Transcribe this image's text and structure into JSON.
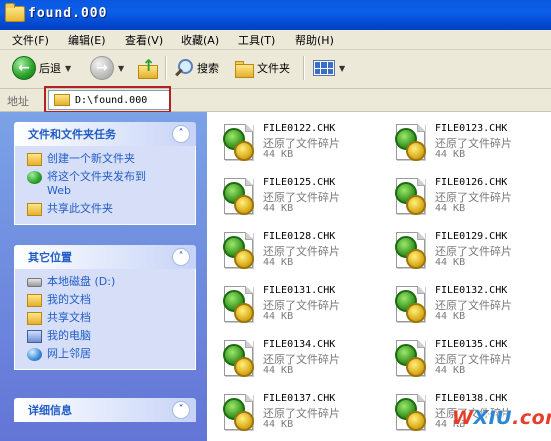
{
  "window": {
    "title": "found.000"
  },
  "menu": [
    "文件(F)",
    "编辑(E)",
    "查看(V)",
    "收藏(A)",
    "工具(T)",
    "帮助(H)"
  ],
  "toolbar": {
    "back": "后退",
    "search": "搜索",
    "folders": "文件夹"
  },
  "address": {
    "label": "地址",
    "value": "D:\\found.000"
  },
  "tasks_panel": {
    "title": "文件和文件夹任务",
    "items": [
      "创建一个新文件夹",
      "将这个文件夹发布到",
      "Web",
      "共享此文件夹"
    ]
  },
  "places_panel": {
    "title": "其它位置",
    "items": [
      "本地磁盘 (D:)",
      "我的文档",
      "共享文档",
      "我的电脑",
      "网上邻居"
    ]
  },
  "details_panel": {
    "title": "详细信息"
  },
  "files": [
    {
      "name": "FILE0122.CHK",
      "type": "还原了文件碎片",
      "size": "44 KB"
    },
    {
      "name": "FILE0123.CHK",
      "type": "还原了文件碎片",
      "size": "44 KB"
    },
    {
      "name": "FILE0125.CHK",
      "type": "还原了文件碎片",
      "size": "44 KB"
    },
    {
      "name": "FILE0126.CHK",
      "type": "还原了文件碎片",
      "size": "44 KB"
    },
    {
      "name": "FILE0128.CHK",
      "type": "还原了文件碎片",
      "size": "44 KB"
    },
    {
      "name": "FILE0129.CHK",
      "type": "还原了文件碎片",
      "size": "44 KB"
    },
    {
      "name": "FILE0131.CHK",
      "type": "还原了文件碎片",
      "size": "44 KB"
    },
    {
      "name": "FILE0132.CHK",
      "type": "还原了文件碎片",
      "size": "44 KB"
    },
    {
      "name": "FILE0134.CHK",
      "type": "还原了文件碎片",
      "size": "44 KB"
    },
    {
      "name": "FILE0135.CHK",
      "type": "还原了文件碎片",
      "size": "44 KB"
    },
    {
      "name": "FILE0137.CHK",
      "type": "还原了文件碎片",
      "size": "44 KB"
    },
    {
      "name": "FILE0138.CHK",
      "type": "还原了文件碎片",
      "size": "44 KB"
    }
  ],
  "watermark": {
    "part1": "W",
    "part2": "XIU",
    "part3": ".com"
  },
  "colors": {
    "title_bar": "#0a58e0",
    "task_link": "#215dc6",
    "sidebar": "#6f8de0",
    "highlight": "#b22222"
  }
}
